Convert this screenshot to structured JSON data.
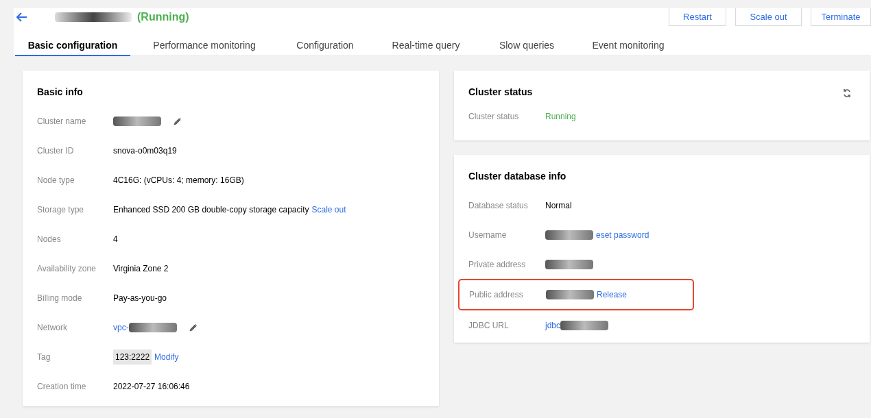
{
  "header": {
    "status": "(Running)",
    "buttons": [
      "Restart",
      "Scale out",
      "Terminate"
    ]
  },
  "tabs": [
    {
      "label": "Basic configuration",
      "selected": true
    },
    {
      "label": "Performance monitoring",
      "selected": false
    },
    {
      "label": "Configuration",
      "selected": false
    },
    {
      "label": "Real-time query",
      "selected": false
    },
    {
      "label": "Slow queries",
      "selected": false
    },
    {
      "label": "Event monitoring",
      "selected": false
    }
  ],
  "basic_info": {
    "title": "Basic info",
    "rows": [
      {
        "label": "Cluster name",
        "highlighted": false,
        "parts": [
          {
            "kind": "redacted"
          },
          {
            "kind": "edit"
          }
        ]
      },
      {
        "label": "Cluster ID",
        "highlighted": false,
        "parts": [
          {
            "kind": "text",
            "text": "snova-o0m03q19"
          }
        ]
      },
      {
        "label": "Node type",
        "highlighted": false,
        "parts": [
          {
            "kind": "text",
            "text": "4C16G: (vCPUs: 4; memory: 16GB)"
          }
        ]
      },
      {
        "label": "Storage type",
        "highlighted": false,
        "parts": [
          {
            "kind": "text",
            "text": "Enhanced SSD 200 GB double-copy storage capacity"
          },
          {
            "kind": "link",
            "text": "Scale out"
          }
        ]
      },
      {
        "label": "Nodes",
        "highlighted": false,
        "parts": [
          {
            "kind": "text",
            "text": "4"
          }
        ]
      },
      {
        "label": "Availability zone",
        "highlighted": false,
        "parts": [
          {
            "kind": "text",
            "text": "Virginia Zone 2"
          }
        ]
      },
      {
        "label": "Billing mode",
        "highlighted": false,
        "parts": [
          {
            "kind": "text",
            "text": "Pay-as-you-go"
          }
        ]
      },
      {
        "label": "Network",
        "highlighted": false,
        "parts": [
          {
            "kind": "link",
            "text": "vpc-"
          },
          {
            "kind": "redacted"
          },
          {
            "kind": "edit"
          }
        ]
      },
      {
        "label": "Tag",
        "highlighted": false,
        "parts": [
          {
            "kind": "tag",
            "text": "123:2222"
          },
          {
            "kind": "link",
            "text": "Modify"
          }
        ]
      },
      {
        "label": "Creation time",
        "highlighted": false,
        "parts": [
          {
            "kind": "text",
            "text": "2022-07-27 16:06:46"
          }
        ]
      }
    ]
  },
  "cluster_status": {
    "title": "Cluster status",
    "rows": [
      {
        "label": "Cluster status",
        "highlighted": false,
        "parts": [
          {
            "kind": "status",
            "text": "Running"
          }
        ]
      }
    ]
  },
  "database_info": {
    "title": "Cluster database info",
    "rows": [
      {
        "label": "Database status",
        "highlighted": false,
        "parts": [
          {
            "kind": "text",
            "text": "Normal"
          }
        ]
      },
      {
        "label": "Username",
        "highlighted": false,
        "parts": [
          {
            "kind": "redacted"
          },
          {
            "kind": "link",
            "text": "eset password"
          }
        ]
      },
      {
        "label": "Private address",
        "highlighted": false,
        "parts": [
          {
            "kind": "redacted"
          }
        ]
      },
      {
        "label": "Public address",
        "highlighted": true,
        "parts": [
          {
            "kind": "redacted"
          },
          {
            "kind": "link",
            "text": "Release"
          }
        ]
      },
      {
        "label": "JDBC URL",
        "highlighted": false,
        "parts": [
          {
            "kind": "link",
            "text": "jdbc"
          },
          {
            "kind": "redacted"
          }
        ]
      }
    ]
  }
}
